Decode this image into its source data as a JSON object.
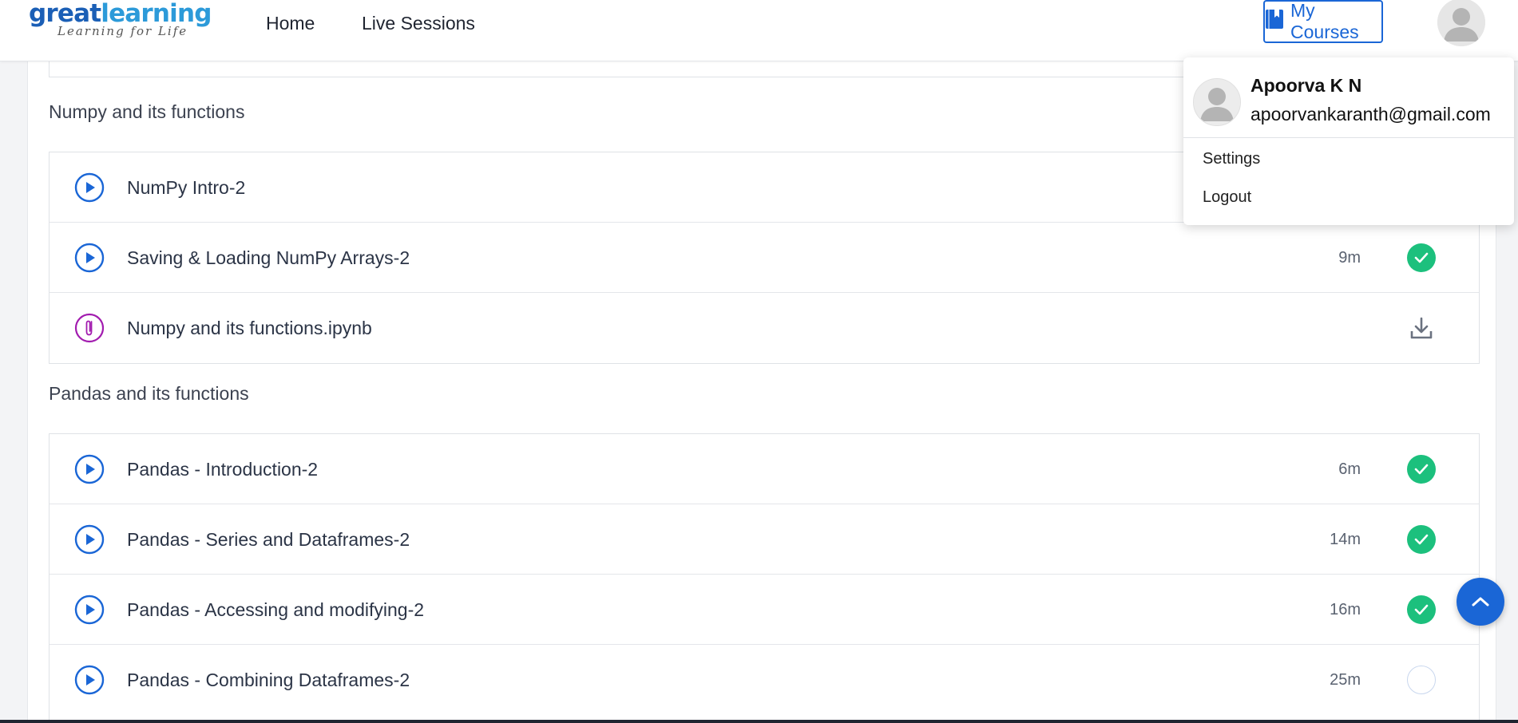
{
  "brand": {
    "name_part1": "great",
    "name_part2": "learning",
    "tagline": "Learning for Life",
    "color_primary": "#1b5fb6",
    "color_secondary": "#2c9ad9"
  },
  "nav": {
    "home": "Home",
    "live_sessions": "Live Sessions",
    "my_courses": "My Courses"
  },
  "user_menu": {
    "name": "Apoorva K N",
    "email": "apoorvankaranth@gmail.com",
    "settings": "Settings",
    "logout": "Logout"
  },
  "sections": [
    {
      "title": "Numpy and its functions",
      "items": [
        {
          "title": "NumPy Intro-2",
          "type": "video",
          "duration": "",
          "status": "completed"
        },
        {
          "title": "Saving & Loading NumPy Arrays-2",
          "type": "video",
          "duration": "9m",
          "status": "completed"
        },
        {
          "title": "Numpy and its functions.ipynb",
          "type": "attachment",
          "duration": "",
          "status": "download"
        }
      ]
    },
    {
      "title": "Pandas and its functions",
      "items": [
        {
          "title": "Pandas - Introduction-2",
          "type": "video",
          "duration": "6m",
          "status": "completed"
        },
        {
          "title": "Pandas - Series and Dataframes-2",
          "type": "video",
          "duration": "14m",
          "status": "completed"
        },
        {
          "title": "Pandas - Accessing and modifying-2",
          "type": "video",
          "duration": "16m",
          "status": "completed"
        },
        {
          "title": "Pandas - Combining Dataframes-2",
          "type": "video",
          "duration": "25m",
          "status": "incomplete"
        }
      ]
    }
  ],
  "icons": {
    "video": "play-circle-icon",
    "attachment": "paperclip-icon",
    "completed": "check-circle-icon",
    "download": "download-icon",
    "incomplete": "empty-circle-icon"
  },
  "colors": {
    "accent": "#1a66d6",
    "success": "#1cc07d",
    "attachment": "#a21caf"
  }
}
